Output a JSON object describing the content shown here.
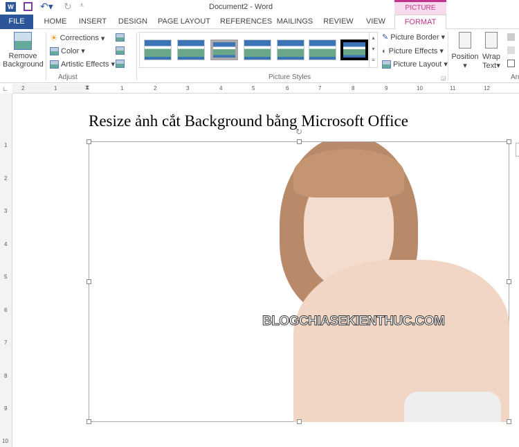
{
  "titlebar": {
    "title": "Document2 - Word",
    "context_label": "PICTURE TOOLS"
  },
  "tabs": [
    "FILE",
    "HOME",
    "INSERT",
    "DESIGN",
    "PAGE LAYOUT",
    "REFERENCES",
    "MAILINGS",
    "REVIEW",
    "VIEW",
    "FORMAT"
  ],
  "active_tab": "FORMAT",
  "ribbon": {
    "adjust": {
      "label": "Adjust",
      "remove_background": [
        "Remove",
        "Background"
      ],
      "corrections": "Corrections",
      "color": "Color",
      "artistic_effects": "Artistic Effects"
    },
    "picture_styles": {
      "label": "Picture Styles",
      "style_count": 7,
      "selected_index": 2
    },
    "picture_border": "Picture Border",
    "picture_effects": "Picture Effects",
    "picture_layout": "Picture Layout",
    "arrange": {
      "label": "Arr",
      "position": "Position",
      "wrap_text": [
        "Wrap",
        "Text"
      ]
    }
  },
  "ruler": {
    "h": [
      "2",
      "1",
      "1",
      "2",
      "3",
      "4",
      "5",
      "6",
      "7",
      "8",
      "9",
      "10",
      "11",
      "12"
    ],
    "v": [
      "1",
      "2",
      "3",
      "4",
      "5",
      "6",
      "7",
      "8",
      "9",
      "10"
    ]
  },
  "document": {
    "heading": "Resize ảnh cắt Background bằng Microsoft Office",
    "watermark": "BLOGCHIASEKIENTHUC.COM"
  },
  "colors": {
    "file_tab": "#2b579a",
    "context": "#c0338f",
    "context_bg": "#f7dbed"
  }
}
